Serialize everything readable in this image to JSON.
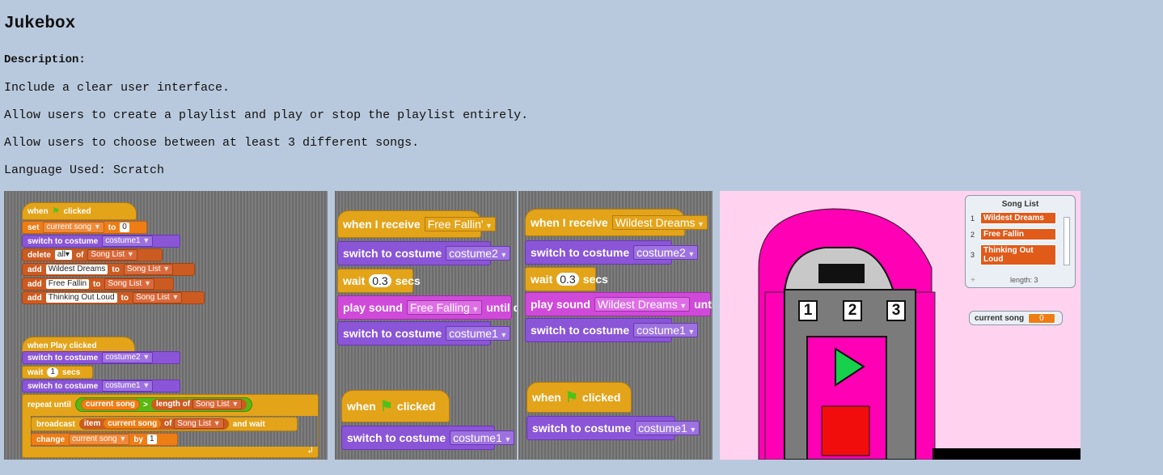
{
  "page": {
    "title": "Jukebox",
    "description_label": "Description:",
    "lines": [
      "Include a clear user interface.",
      "Allow users to create a playlist and play or stop the playlist entirely.",
      "Allow users to choose between at least 3 different songs.",
      "Language Used: Scratch"
    ]
  },
  "panel1": {
    "when_flag": {
      "when": "when",
      "clicked": "clicked"
    },
    "set": {
      "kw": "set",
      "var": "current song",
      "to": "to",
      "val": "0"
    },
    "switch1": {
      "kw": "switch to costume",
      "val": "costume1"
    },
    "delete": {
      "kw": "delete",
      "val": "all",
      "of": "of",
      "list": "Song List"
    },
    "add1": {
      "kw": "add",
      "val": "Wildest Dreams",
      "to": "to",
      "list": "Song List"
    },
    "add2": {
      "kw": "add",
      "val": "Free Fallin",
      "to": "to",
      "list": "Song List"
    },
    "add3": {
      "kw": "add",
      "val": "Thinking Out Loud",
      "to": "to",
      "list": "Song List"
    },
    "when_play": "when Play clicked",
    "switch2": {
      "kw": "switch to costume",
      "val": "costume2"
    },
    "wait": {
      "kw": "wait",
      "val": "1",
      "unit": "secs"
    },
    "switch3": {
      "kw": "switch to costume",
      "val": "costume1"
    },
    "repeat": {
      "kw": "repeat until",
      "var": "current song",
      "op": ">",
      "len": "length of",
      "list": "Song List"
    },
    "broadcast": {
      "kw": "broadcast",
      "item": "item",
      "var": "current song",
      "of": "of",
      "list": "Song List",
      "tail": "and wait"
    },
    "change": {
      "kw": "change",
      "var": "current song",
      "by": "by",
      "val": "1"
    }
  },
  "panel2": {
    "receive": {
      "kw": "when I receive",
      "val": "Free Fallin'"
    },
    "switch_a": {
      "kw": "switch to costume",
      "val": "costume2"
    },
    "wait": {
      "kw": "wait",
      "val": "0.3",
      "unit": "secs"
    },
    "play": {
      "kw": "play sound",
      "val": "Free Falling",
      "tail": "until done"
    },
    "switch_b": {
      "kw": "switch to costume",
      "val": "costume1"
    },
    "flag": {
      "when": "when",
      "clicked": "clicked"
    },
    "switch_c": {
      "kw": "switch to costume",
      "val": "costume1"
    }
  },
  "panel3": {
    "receive": {
      "kw": "when I receive",
      "val": "Wildest Dreams"
    },
    "switch_a": {
      "kw": "switch to costume",
      "val": "costume2"
    },
    "wait": {
      "kw": "wait",
      "val": "0.3",
      "unit": "secs"
    },
    "play": {
      "kw": "play sound",
      "val": "Wildest Dreams",
      "tail": "until done"
    },
    "switch_b": {
      "kw": "switch to costume",
      "val": "costume1"
    },
    "flag": {
      "when": "when",
      "clicked": "clicked"
    },
    "switch_c": {
      "kw": "switch to costume",
      "val": "costume1"
    }
  },
  "stage": {
    "buttons": [
      "1",
      "2",
      "3"
    ],
    "song_list": {
      "title": "Song List",
      "items": [
        "Wildest Dreams",
        "Free Fallin",
        "Thinking Out Loud"
      ],
      "indices": [
        "1",
        "2",
        "3"
      ],
      "plus": "+",
      "length": "length: 3"
    },
    "current_song": {
      "label": "current song",
      "value": "0"
    }
  },
  "colors": {
    "background": "#b9c9dd",
    "events": "#e3a41a",
    "looks": "#8a55d7",
    "data": "#ee7d16",
    "lists": "#cc5b22",
    "sound": "#cf4ad9",
    "operators": "#5cb712",
    "jukebox": "#ff00b4"
  }
}
